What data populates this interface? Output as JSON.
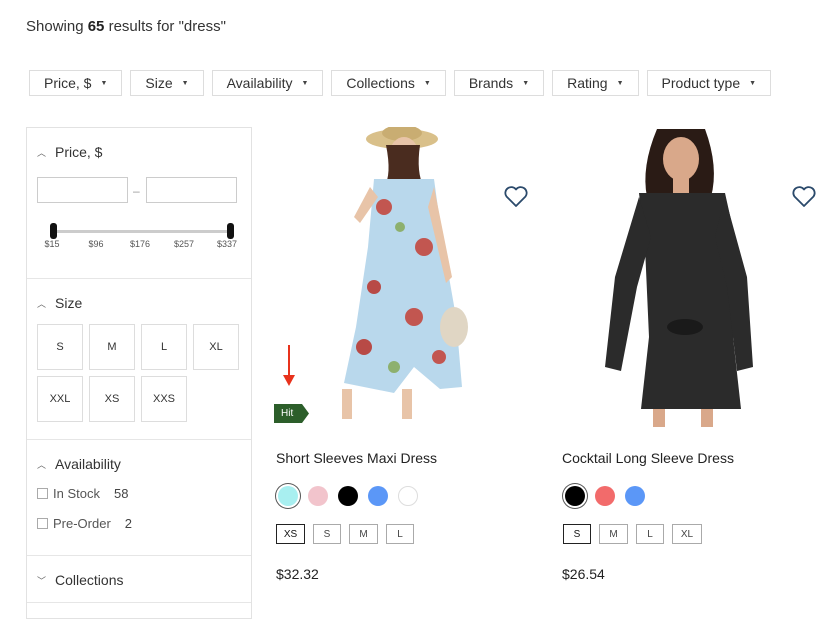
{
  "results": {
    "prefix": "Showing",
    "count": "65",
    "suffix": "results for \"dress\""
  },
  "filters": [
    "Price, $",
    "Size",
    "Availability",
    "Collections",
    "Brands",
    "Rating",
    "Product type"
  ],
  "sidebar": {
    "price": {
      "title": "Price, $",
      "min_placeholder": "",
      "max_placeholder": "",
      "ticks": [
        "$15",
        "$96",
        "$176",
        "$257",
        "$337"
      ],
      "range": [
        15,
        337
      ]
    },
    "size": {
      "title": "Size",
      "options": [
        "S",
        "M",
        "L",
        "XL",
        "XXL",
        "XS",
        "XXS"
      ]
    },
    "availability": {
      "title": "Availability",
      "options": [
        {
          "label": "In Stock",
          "count": "58"
        },
        {
          "label": "Pre-Order",
          "count": "2"
        }
      ]
    },
    "collections": {
      "title": "Collections"
    }
  },
  "products": [
    {
      "title": "Short Sleeves Maxi Dress",
      "badge": "Hit",
      "price": "$32.32",
      "colors": [
        "#a8eff0",
        "#f2c4cc",
        "#000000",
        "#5b97f7",
        "#ffffff"
      ],
      "selected_color": 0,
      "sizes": [
        "XS",
        "S",
        "M",
        "L"
      ],
      "selected_size": 0
    },
    {
      "title": "Cocktail Long Sleeve Dress",
      "price": "$26.54",
      "colors": [
        "#000000",
        "#f26b6b",
        "#5b97f7"
      ],
      "selected_color": 0,
      "sizes": [
        "S",
        "M",
        "L",
        "XL"
      ],
      "selected_size": 0
    }
  ],
  "colors": {
    "badge": "#2c5e2a",
    "annotation_arrow": "#e8321c"
  }
}
